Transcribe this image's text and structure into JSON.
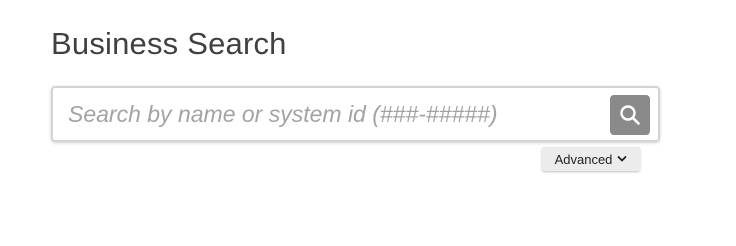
{
  "page": {
    "title": "Business Search"
  },
  "search": {
    "placeholder": "Search by name or system id (###-#####)",
    "value": "",
    "button_icon": "search-icon"
  },
  "advanced": {
    "label": "Advanced",
    "icon": "chevron-down-icon"
  },
  "colors": {
    "title_text": "#404040",
    "placeholder_text": "#a3a3a3",
    "search_button_bg": "#8a8a8a",
    "advanced_bg": "#ececec"
  }
}
